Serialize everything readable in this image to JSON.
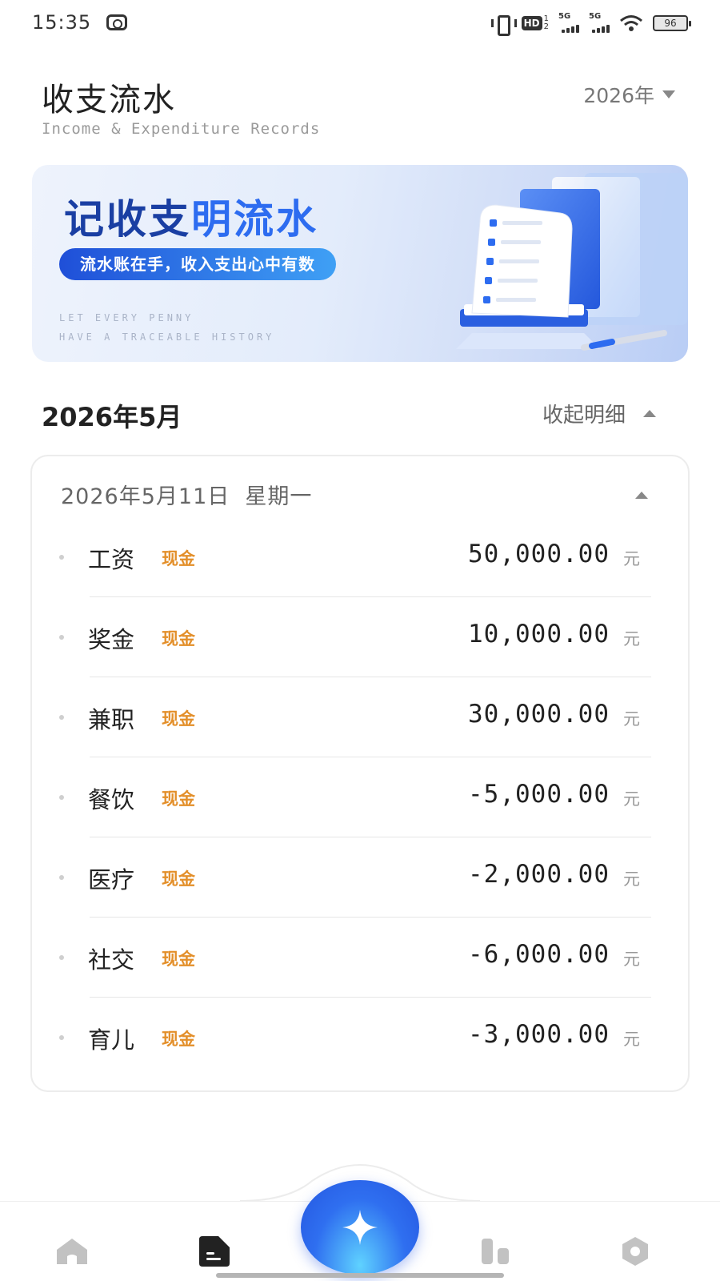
{
  "status_bar": {
    "time": "15:35",
    "battery": "96",
    "network_1": "5G",
    "network_2": "5G",
    "hd": "HD",
    "hd_sub_1": "1",
    "hd_sub_2": "2"
  },
  "header": {
    "title": "收支流水",
    "subtitle": "Income & Expenditure Records",
    "year_selector": "2026年"
  },
  "banner": {
    "title_main": "记收支",
    "title_accent": "明流水",
    "pill": "流水账在手，收入支出心中有数",
    "eng_line_1": "LET EVERY PENNY",
    "eng_line_2": "HAVE A TRACEABLE HISTORY"
  },
  "section": {
    "month": "2026年5月",
    "toggle_label": "收起明细"
  },
  "day": {
    "header": "2026年5月11日  星期一",
    "entries": [
      {
        "category": "工资",
        "account": "现金",
        "amount": "50,000.00",
        "unit": "元"
      },
      {
        "category": "奖金",
        "account": "现金",
        "amount": "10,000.00",
        "unit": "元"
      },
      {
        "category": "兼职",
        "account": "现金",
        "amount": "30,000.00",
        "unit": "元"
      },
      {
        "category": "餐饮",
        "account": "现金",
        "amount": "-5,000.00",
        "unit": "元"
      },
      {
        "category": "医疗",
        "account": "现金",
        "amount": "-2,000.00",
        "unit": "元"
      },
      {
        "category": "社交",
        "account": "现金",
        "amount": "-6,000.00",
        "unit": "元"
      },
      {
        "category": "育儿",
        "account": "现金",
        "amount": "-3,000.00",
        "unit": "元"
      }
    ]
  },
  "bottom_nav": {
    "items": [
      "home-icon",
      "records-icon",
      "add-icon",
      "stats-icon",
      "settings-icon"
    ],
    "active": "records-icon",
    "accent": "#2f6ff0"
  },
  "colors": {
    "account_tag": "#e38f2a",
    "banner_title": "#1a3fa3",
    "nav_icon": "#c2c2c2",
    "nav_icon_active": "#222222"
  }
}
